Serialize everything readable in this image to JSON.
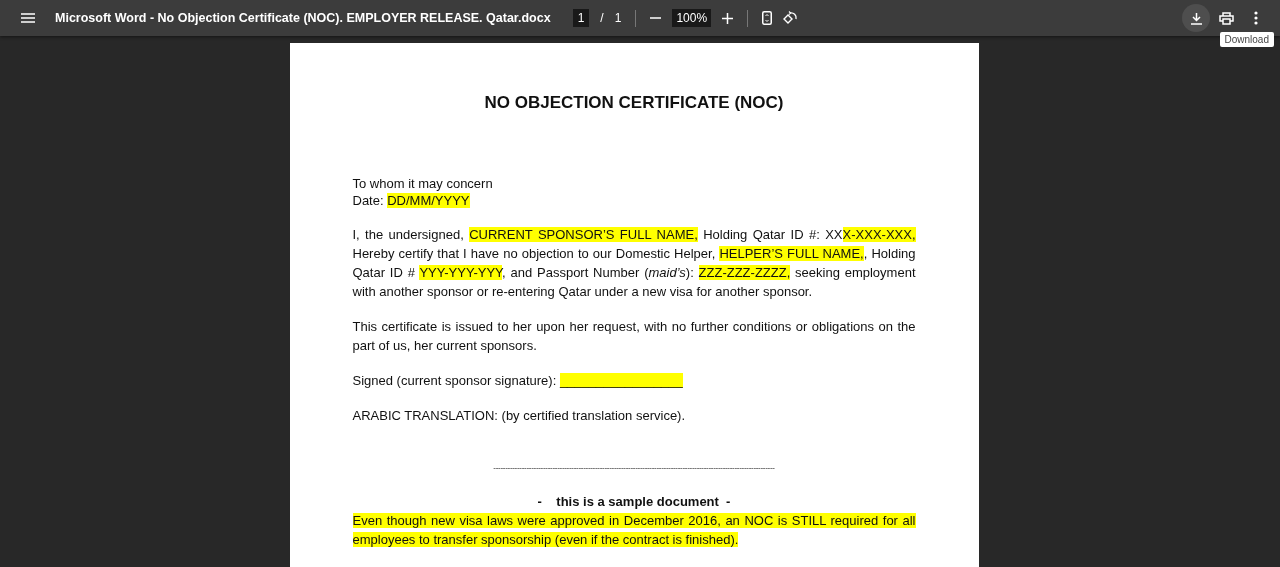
{
  "toolbar": {
    "title": "Microsoft Word - No Objection Certificate (NOC). EMPLOYER RELEASE. Qatar.docx",
    "page_current": "1",
    "page_separator": "/",
    "page_total": "1",
    "zoom": "100%",
    "right_buttons": [
      {
        "kind": "download",
        "hovered": true
      },
      {
        "kind": "print",
        "hovered": false
      },
      {
        "kind": "more",
        "hovered": false
      }
    ],
    "tooltip": "Download"
  },
  "document": {
    "heading": "NO OBJECTION CERTIFICATE (NOC)",
    "paragraphs": [
      {
        "kind": "lines",
        "lines": [
          [
            {
              "text": "To whom it may concern",
              "highlighted": false
            }
          ],
          [
            {
              "text": "Date: ",
              "highlighted": false
            },
            {
              "text": "DD/MM/YYYY",
              "highlighted": true
            }
          ]
        ]
      },
      {
        "kind": "justified",
        "segments": [
          {
            "text": "I, the undersigned, ",
            "highlighted": false
          },
          {
            "text": "CURRENT SPONSOR’S FULL NAME,",
            "highlighted": true
          },
          {
            "text": " Holding Qatar ID #: XX",
            "highlighted": false
          },
          {
            "text": "X-XXX-XXX,   ",
            "highlighted": true
          },
          {
            "text": " Hereby certify that I have no objection to our Domestic Helper, ",
            "highlighted": false
          },
          {
            "text": "HELPER’S FULL NAME,",
            "highlighted": true
          },
          {
            "text": ", Holding Qatar ID # ",
            "highlighted": false
          },
          {
            "text": "YYY-YYY-YYY",
            "highlighted": true
          },
          {
            "text": ", and Passport Number (*maid’s*): ",
            "highlighted": false
          },
          {
            "text": "ZZZ-ZZZ-ZZZZ,",
            "highlighted": true
          },
          {
            "text": " seeking employment with another sponsor or re-entering Qatar under a new visa for another sponsor.",
            "highlighted": false
          }
        ]
      },
      {
        "kind": "justified",
        "segments": [
          {
            "text": "This certificate is issued to her upon her request, with no further conditions or obligations on the part of us, her current sponsors.",
            "highlighted": false
          }
        ]
      },
      {
        "kind": "signature",
        "segments": [
          {
            "text": "Signed (current sponsor signature): ",
            "highlighted": false
          },
          {
            "text": "_________________",
            "highlighted": true
          }
        ]
      },
      {
        "kind": "justified",
        "segments": [
          {
            "text": "ARABIC TRANSLATION: (by certified translation service).",
            "highlighted": false
          }
        ]
      },
      {
        "kind": "rule",
        "text": "-----------------------------------------------------------------------------------------------------------------------"
      },
      {
        "kind": "centered-bold",
        "text": "-    this is a sample document  -"
      },
      {
        "kind": "justified",
        "segments": [
          {
            "text": "Even though new visa laws were approved in December 2016, an NOC is STILL required for all employees to transfer sponsorship (even if the contract is finished).",
            "highlighted": true
          }
        ]
      }
    ]
  }
}
